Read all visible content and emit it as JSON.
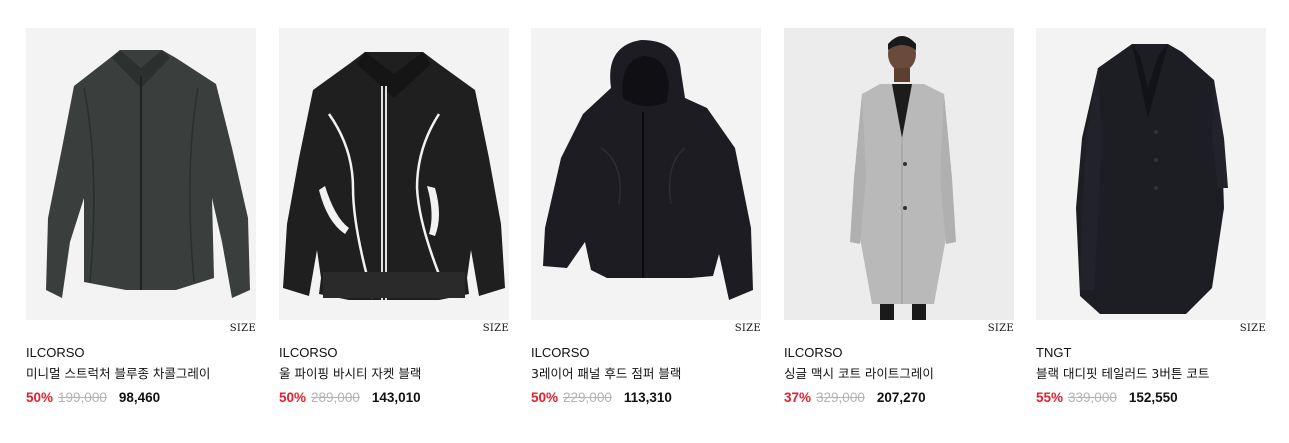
{
  "products": [
    {
      "brand": "ILCORSO",
      "name": "미니멀 스트럭처 블루종 차콜그레이",
      "discount": "50%",
      "original_price": "199,000",
      "price": "98,460",
      "size_label": "SIZE"
    },
    {
      "brand": "ILCORSO",
      "name": "울 파이핑 바시티 자켓 블랙",
      "discount": "50%",
      "original_price": "289,000",
      "price": "143,010",
      "size_label": "SIZE"
    },
    {
      "brand": "ILCORSO",
      "name": "3레이어 패널 후드 점퍼 블랙",
      "discount": "50%",
      "original_price": "229,000",
      "price": "113,310",
      "size_label": "SIZE"
    },
    {
      "brand": "ILCORSO",
      "name": "싱글 맥시 코트 라이트그레이",
      "discount": "37%",
      "original_price": "329,000",
      "price": "207,270",
      "size_label": "SIZE"
    },
    {
      "brand": "TNGT",
      "name": "블랙 대디핏 테일러드 3버튼 코트",
      "discount": "55%",
      "original_price": "339,000",
      "price": "152,550",
      "size_label": "SIZE"
    }
  ],
  "colors": {
    "discount": "#e4202e",
    "original_price": "#b3b3b3",
    "thumb_bg": "#f3f3f3"
  }
}
